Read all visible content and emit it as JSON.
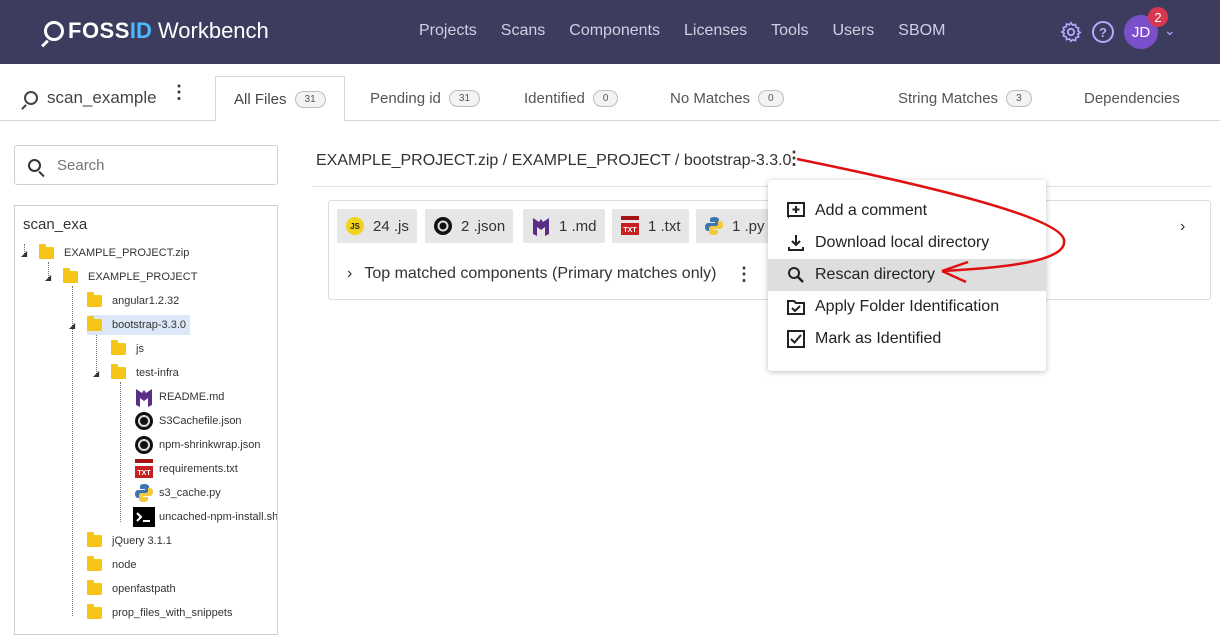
{
  "topbar": {
    "brand_foss": "FOSS",
    "brand_id": "ID",
    "brand_rest": "Workbench",
    "nav": [
      "Projects",
      "Scans",
      "Components",
      "Licenses",
      "Tools",
      "Users",
      "SBOM"
    ],
    "user_initials": "JD",
    "notification_count": "2",
    "colors": {
      "bar": "#3c3c5e",
      "accent": "#4cb8ff",
      "avatar": "#7b4fc9",
      "badge": "#d9364f"
    }
  },
  "scan": {
    "name": "scan_example"
  },
  "tabs": [
    {
      "label": "All Files",
      "count": "31"
    },
    {
      "label": "Pending id",
      "count": "31"
    },
    {
      "label": "Identified",
      "count": "0"
    },
    {
      "label": "No Matches",
      "count": "0"
    },
    {
      "label": "String Matches",
      "count": "3"
    },
    {
      "label": "Dependencies",
      "count": ""
    }
  ],
  "search": {
    "placeholder": "Search"
  },
  "tree": {
    "root": "scan_exa",
    "nodes": [
      {
        "label": "EXAMPLE_PROJECT.zip",
        "type": "folder"
      },
      {
        "label": "EXAMPLE_PROJECT",
        "type": "folder"
      },
      {
        "label": "angular1.2.32",
        "type": "folder"
      },
      {
        "label": "bootstrap-3.3.0",
        "type": "folder"
      },
      {
        "label": "js",
        "type": "folder"
      },
      {
        "label": "test-infra",
        "type": "folder"
      },
      {
        "label": "README.md",
        "type": "md-icon"
      },
      {
        "label": "S3Cachefile.json",
        "type": "json-icon"
      },
      {
        "label": "npm-shrinkwrap.json",
        "type": "json-icon"
      },
      {
        "label": "requirements.txt",
        "type": "txt-icon"
      },
      {
        "label": "s3_cache.py",
        "type": "python-icon"
      },
      {
        "label": "uncached-npm-install.sh",
        "type": "terminal-icon"
      },
      {
        "label": "jQuery 3.1.1",
        "type": "folder"
      },
      {
        "label": "node",
        "type": "folder"
      },
      {
        "label": "openfastpath",
        "type": "folder"
      },
      {
        "label": "prop_files_with_snippets",
        "type": "folder"
      }
    ]
  },
  "breadcrumb": "EXAMPLE_PROJECT.zip / EXAMPLE_PROJECT / bootstrap-3.3.0",
  "filetypes": [
    {
      "count": "24",
      "ext": ".js",
      "icon": "js-icon"
    },
    {
      "count": "2",
      "ext": ".json",
      "icon": "json-icon"
    },
    {
      "count": "1",
      "ext": ".md",
      "icon": "md-icon"
    },
    {
      "count": "1",
      "ext": ".txt",
      "icon": "txt-icon"
    },
    {
      "count": "1",
      "ext": ".py",
      "icon": "python-icon"
    }
  ],
  "top_matched": "Top matched components (Primary matches only)",
  "menu": {
    "items": [
      {
        "label": "Add a comment",
        "icon": "add-comment-icon"
      },
      {
        "label": "Download local directory",
        "icon": "download-icon"
      },
      {
        "label": "Rescan directory",
        "icon": "search-icon"
      },
      {
        "label": "Apply Folder Identification",
        "icon": "folder-check-icon"
      },
      {
        "label": "Mark as Identified",
        "icon": "checkbox-icon"
      }
    ]
  }
}
